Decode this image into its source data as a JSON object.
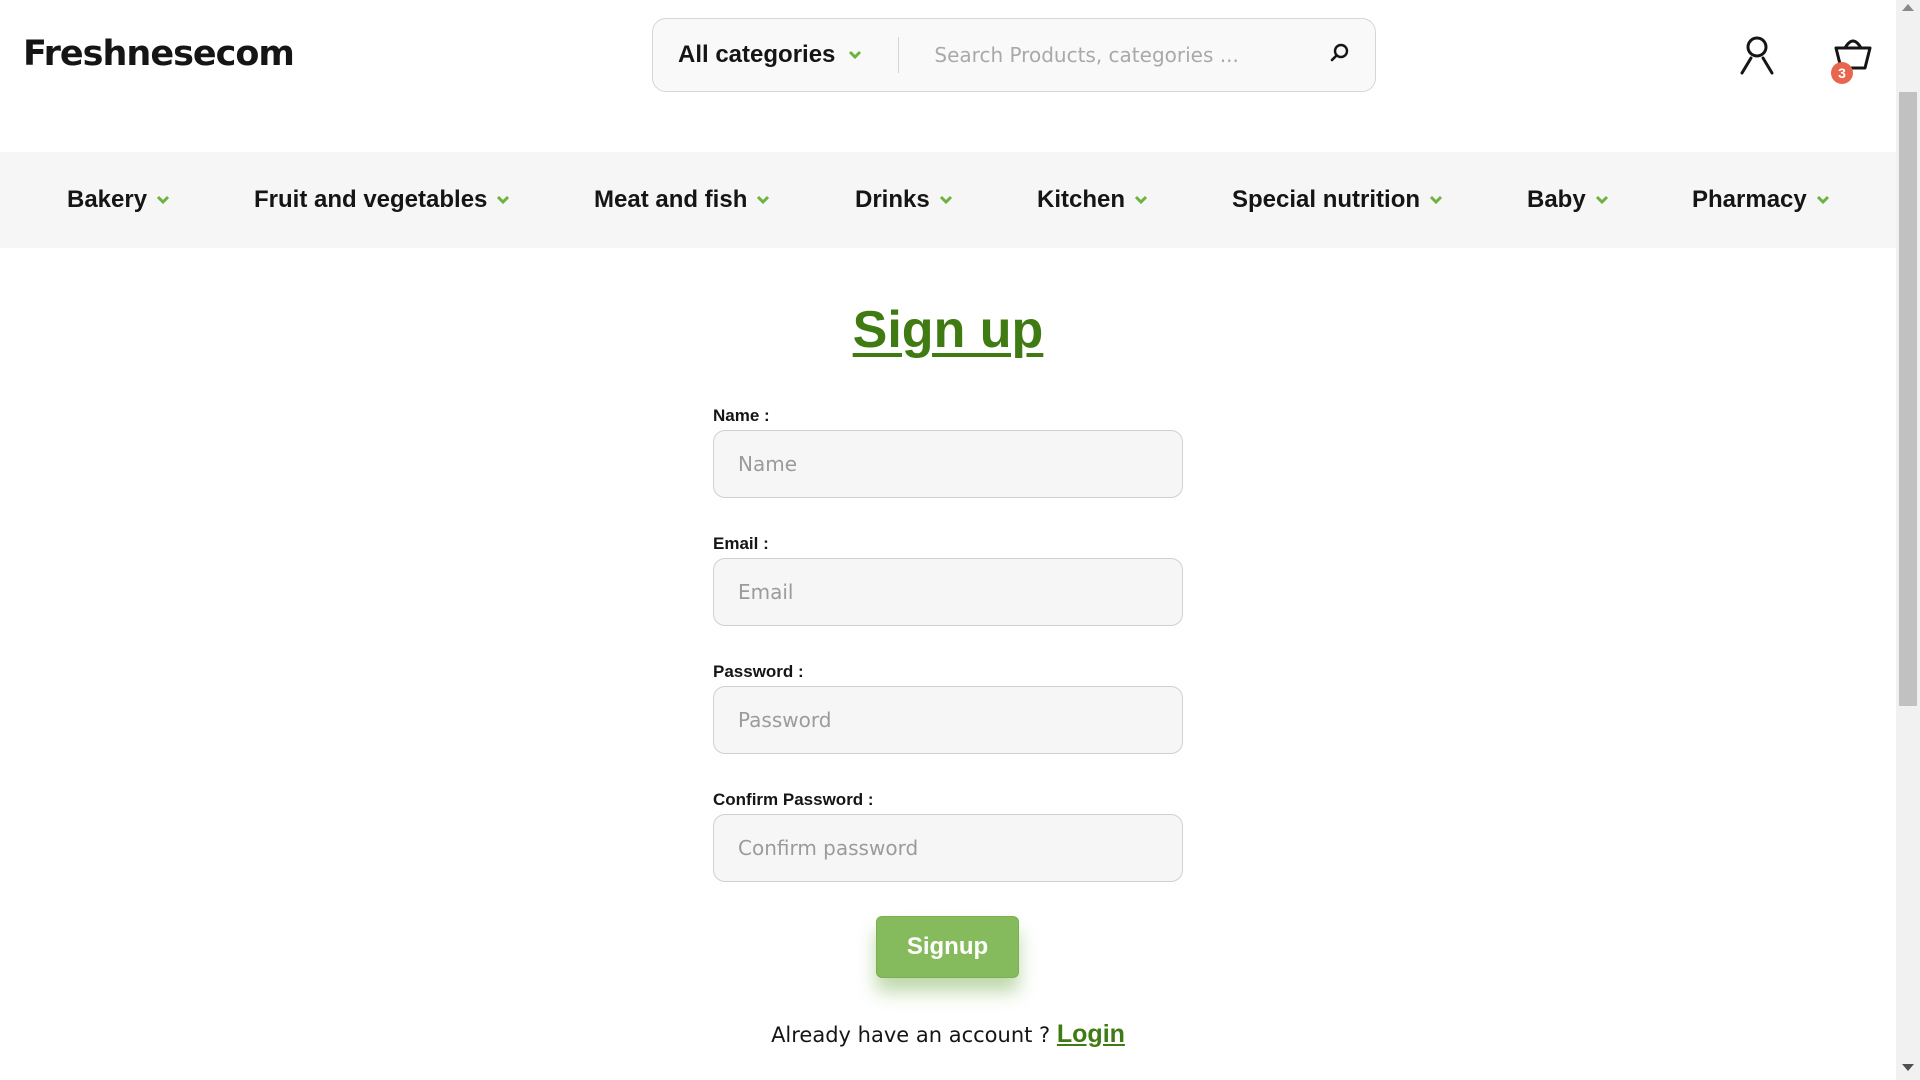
{
  "header": {
    "logo": "Freshnesecom",
    "category_select": "All categories",
    "search_placeholder": "Search Products, categories ...",
    "cart_count": "3",
    "icons": {
      "category": "chevron-down-icon",
      "search": "search-icon",
      "user": "user-icon",
      "cart": "shopping-basket-icon"
    }
  },
  "nav": {
    "items": [
      {
        "label": "Bakery"
      },
      {
        "label": "Fruit and vegetables"
      },
      {
        "label": "Meat and fish"
      },
      {
        "label": "Drinks"
      },
      {
        "label": "Kitchen"
      },
      {
        "label": "Special nutrition"
      },
      {
        "label": "Baby"
      },
      {
        "label": "Pharmacy"
      }
    ]
  },
  "form": {
    "title": "Sign up",
    "fields": [
      {
        "label": "Name :",
        "placeholder": "Name"
      },
      {
        "label": "Email :",
        "placeholder": "Email"
      },
      {
        "label": "Password :",
        "placeholder": "Password"
      },
      {
        "label": "Confirm Password :",
        "placeholder": "Confirm password"
      }
    ],
    "submit_label": "Signup",
    "login_prompt": "Already have an account ?",
    "login_link": "Login"
  },
  "colors": {
    "accent_green": "#3f7a12",
    "button_green": "#85bb5c",
    "chevron_green": "#6cb33f",
    "badge_red": "#e8664f"
  }
}
